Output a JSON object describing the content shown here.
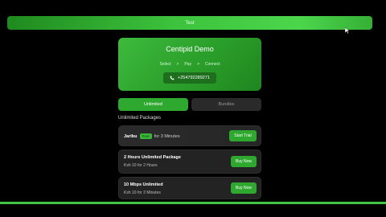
{
  "top_banner": {
    "label": "Test"
  },
  "hero": {
    "title": "Centipid Demo",
    "steps": [
      "Select",
      ">",
      "Pay",
      ">",
      "Connect"
    ],
    "phone": "+254792289271"
  },
  "tabs": [
    {
      "label": "Unlimited",
      "active": true
    },
    {
      "label": "Bundles",
      "active": false
    }
  ],
  "section_title": "Unlimited Packages",
  "trial_card": {
    "name": "Jaribu",
    "badge": "Free",
    "duration": "for 3 Minutes",
    "button": "Start Trial"
  },
  "packages": [
    {
      "name": "2 Hours Unlimited Package",
      "price": "Ksh 10 for 2 Hours",
      "button": "Buy Now"
    },
    {
      "name": "10 Mbps Unlimited",
      "price": "Ksh 10 for 3 Minutes",
      "button": "Buy Now"
    }
  ],
  "colors": {
    "accent": "#2fa82f",
    "background": "#000000",
    "card": "#232323"
  }
}
